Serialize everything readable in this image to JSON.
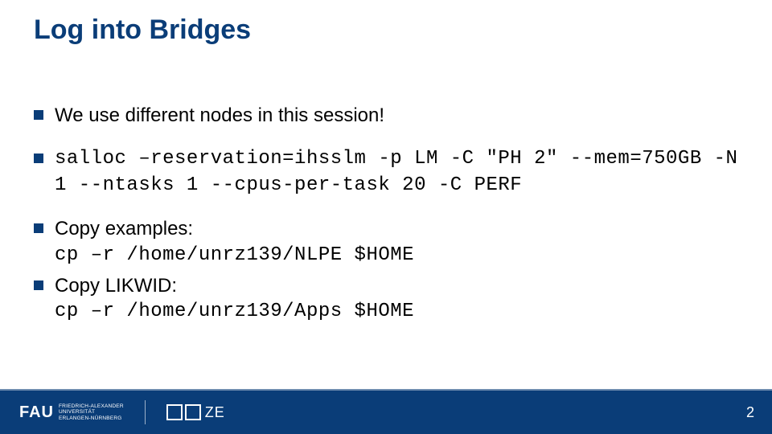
{
  "title": "Log into Bridges",
  "bullets": {
    "b0": "We use different nodes in this session!",
    "b1": "salloc –reservation=ihsslm -p LM -C \"PH 2\" --mem=750GB -N 1  --ntasks 1 --cpus-per-task 20 -C PERF",
    "b2_label": "Copy examples:",
    "b2_code": "cp –r /home/unrz139/NLPE $HOME",
    "b3_label": "Copy LIKWID:",
    "b3_code": "cp –r /home/unrz139/Apps $HOME"
  },
  "footer": {
    "logo1": "FAU",
    "logo1_sub1": "FRIEDRICH-ALEXANDER",
    "logo1_sub2": "UNIVERSITÄT",
    "logo1_sub3": "ERLANGEN-NÜRNBERG",
    "logo2": "ZE",
    "page": "2"
  }
}
